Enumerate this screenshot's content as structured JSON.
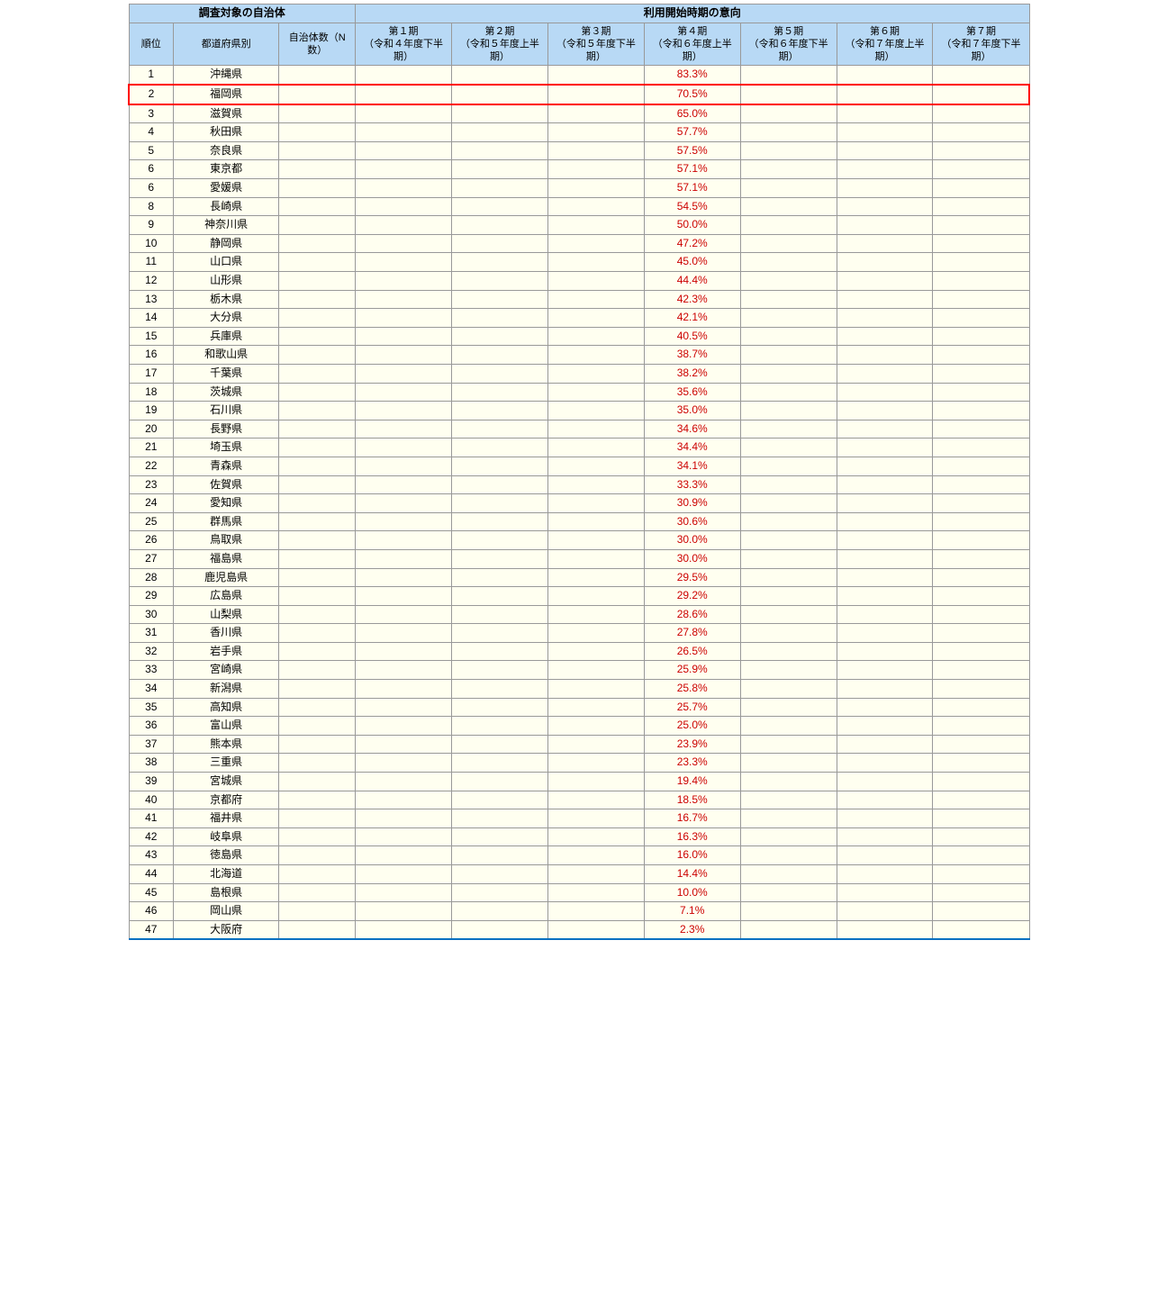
{
  "table": {
    "headers": {
      "survey_group": "調査対象の自治体",
      "intent_group": "利用開始時期の意向",
      "rank_label": "順位",
      "pref_label": "都道府県別",
      "count_label": "自治体数（N数）",
      "periods": [
        {
          "label": "第１期",
          "sub": "（令和４年度下半期）"
        },
        {
          "label": "第２期",
          "sub": "（令和５年度上半期）"
        },
        {
          "label": "第３期",
          "sub": "（令和５年度下半期）"
        },
        {
          "label": "第４期",
          "sub": "（令和６年度上半期）"
        },
        {
          "label": "第５期",
          "sub": "（令和６年度下半期）"
        },
        {
          "label": "第６期",
          "sub": "（令和７年度上半期）"
        },
        {
          "label": "第７期",
          "sub": "（令和７年度下半期）"
        }
      ]
    },
    "rows": [
      {
        "rank": "1",
        "pref": "沖縄県",
        "count": "",
        "p1": "",
        "p2": "",
        "p3": "",
        "p4": "83.3%",
        "p5": "",
        "p6": "",
        "p7": "",
        "red_outline": false,
        "blue_bottom": false
      },
      {
        "rank": "2",
        "pref": "福岡県",
        "count": "",
        "p1": "",
        "p2": "",
        "p3": "",
        "p4": "70.5%",
        "p5": "",
        "p6": "",
        "p7": "",
        "red_outline": true,
        "blue_bottom": false
      },
      {
        "rank": "3",
        "pref": "滋賀県",
        "count": "",
        "p1": "",
        "p2": "",
        "p3": "",
        "p4": "65.0%",
        "p5": "",
        "p6": "",
        "p7": "",
        "red_outline": false,
        "blue_bottom": false
      },
      {
        "rank": "4",
        "pref": "秋田県",
        "count": "",
        "p1": "",
        "p2": "",
        "p3": "",
        "p4": "57.7%",
        "p5": "",
        "p6": "",
        "p7": "",
        "red_outline": false,
        "blue_bottom": false
      },
      {
        "rank": "5",
        "pref": "奈良県",
        "count": "",
        "p1": "",
        "p2": "",
        "p3": "",
        "p4": "57.5%",
        "p5": "",
        "p6": "",
        "p7": "",
        "red_outline": false,
        "blue_bottom": false
      },
      {
        "rank": "6",
        "pref": "東京都",
        "count": "",
        "p1": "",
        "p2": "",
        "p3": "",
        "p4": "57.1%",
        "p5": "",
        "p6": "",
        "p7": "",
        "red_outline": false,
        "blue_bottom": false
      },
      {
        "rank": "6",
        "pref": "愛媛県",
        "count": "",
        "p1": "",
        "p2": "",
        "p3": "",
        "p4": "57.1%",
        "p5": "",
        "p6": "",
        "p7": "",
        "red_outline": false,
        "blue_bottom": false
      },
      {
        "rank": "8",
        "pref": "長崎県",
        "count": "",
        "p1": "",
        "p2": "",
        "p3": "",
        "p4": "54.5%",
        "p5": "",
        "p6": "",
        "p7": "",
        "red_outline": false,
        "blue_bottom": false
      },
      {
        "rank": "9",
        "pref": "神奈川県",
        "count": "",
        "p1": "",
        "p2": "",
        "p3": "",
        "p4": "50.0%",
        "p5": "",
        "p6": "",
        "p7": "",
        "red_outline": false,
        "blue_bottom": false
      },
      {
        "rank": "10",
        "pref": "静岡県",
        "count": "",
        "p1": "",
        "p2": "",
        "p3": "",
        "p4": "47.2%",
        "p5": "",
        "p6": "",
        "p7": "",
        "red_outline": false,
        "blue_bottom": false
      },
      {
        "rank": "11",
        "pref": "山口県",
        "count": "",
        "p1": "",
        "p2": "",
        "p3": "",
        "p4": "45.0%",
        "p5": "",
        "p6": "",
        "p7": "",
        "red_outline": false,
        "blue_bottom": false
      },
      {
        "rank": "12",
        "pref": "山形県",
        "count": "",
        "p1": "",
        "p2": "",
        "p3": "",
        "p4": "44.4%",
        "p5": "",
        "p6": "",
        "p7": "",
        "red_outline": false,
        "blue_bottom": false
      },
      {
        "rank": "13",
        "pref": "栃木県",
        "count": "",
        "p1": "",
        "p2": "",
        "p3": "",
        "p4": "42.3%",
        "p5": "",
        "p6": "",
        "p7": "",
        "red_outline": false,
        "blue_bottom": false
      },
      {
        "rank": "14",
        "pref": "大分県",
        "count": "",
        "p1": "",
        "p2": "",
        "p3": "",
        "p4": "42.1%",
        "p5": "",
        "p6": "",
        "p7": "",
        "red_outline": false,
        "blue_bottom": false
      },
      {
        "rank": "15",
        "pref": "兵庫県",
        "count": "",
        "p1": "",
        "p2": "",
        "p3": "",
        "p4": "40.5%",
        "p5": "",
        "p6": "",
        "p7": "",
        "red_outline": false,
        "blue_bottom": false
      },
      {
        "rank": "16",
        "pref": "和歌山県",
        "count": "",
        "p1": "",
        "p2": "",
        "p3": "",
        "p4": "38.7%",
        "p5": "",
        "p6": "",
        "p7": "",
        "red_outline": false,
        "blue_bottom": false
      },
      {
        "rank": "17",
        "pref": "千葉県",
        "count": "",
        "p1": "",
        "p2": "",
        "p3": "",
        "p4": "38.2%",
        "p5": "",
        "p6": "",
        "p7": "",
        "red_outline": false,
        "blue_bottom": false
      },
      {
        "rank": "18",
        "pref": "茨城県",
        "count": "",
        "p1": "",
        "p2": "",
        "p3": "",
        "p4": "35.6%",
        "p5": "",
        "p6": "",
        "p7": "",
        "red_outline": false,
        "blue_bottom": false
      },
      {
        "rank": "19",
        "pref": "石川県",
        "count": "",
        "p1": "",
        "p2": "",
        "p3": "",
        "p4": "35.0%",
        "p5": "",
        "p6": "",
        "p7": "",
        "red_outline": false,
        "blue_bottom": false
      },
      {
        "rank": "20",
        "pref": "長野県",
        "count": "",
        "p1": "",
        "p2": "",
        "p3": "",
        "p4": "34.6%",
        "p5": "",
        "p6": "",
        "p7": "",
        "red_outline": false,
        "blue_bottom": false
      },
      {
        "rank": "21",
        "pref": "埼玉県",
        "count": "",
        "p1": "",
        "p2": "",
        "p3": "",
        "p4": "34.4%",
        "p5": "",
        "p6": "",
        "p7": "",
        "red_outline": false,
        "blue_bottom": false
      },
      {
        "rank": "22",
        "pref": "青森県",
        "count": "",
        "p1": "",
        "p2": "",
        "p3": "",
        "p4": "34.1%",
        "p5": "",
        "p6": "",
        "p7": "",
        "red_outline": false,
        "blue_bottom": false
      },
      {
        "rank": "23",
        "pref": "佐賀県",
        "count": "",
        "p1": "",
        "p2": "",
        "p3": "",
        "p4": "33.3%",
        "p5": "",
        "p6": "",
        "p7": "",
        "red_outline": false,
        "blue_bottom": false
      },
      {
        "rank": "24",
        "pref": "愛知県",
        "count": "",
        "p1": "",
        "p2": "",
        "p3": "",
        "p4": "30.9%",
        "p5": "",
        "p6": "",
        "p7": "",
        "red_outline": false,
        "blue_bottom": false
      },
      {
        "rank": "25",
        "pref": "群馬県",
        "count": "",
        "p1": "",
        "p2": "",
        "p3": "",
        "p4": "30.6%",
        "p5": "",
        "p6": "",
        "p7": "",
        "red_outline": false,
        "blue_bottom": false
      },
      {
        "rank": "26",
        "pref": "鳥取県",
        "count": "",
        "p1": "",
        "p2": "",
        "p3": "",
        "p4": "30.0%",
        "p5": "",
        "p6": "",
        "p7": "",
        "red_outline": false,
        "blue_bottom": false
      },
      {
        "rank": "27",
        "pref": "福島県",
        "count": "",
        "p1": "",
        "p2": "",
        "p3": "",
        "p4": "30.0%",
        "p5": "",
        "p6": "",
        "p7": "",
        "red_outline": false,
        "blue_bottom": false
      },
      {
        "rank": "28",
        "pref": "鹿児島県",
        "count": "",
        "p1": "",
        "p2": "",
        "p3": "",
        "p4": "29.5%",
        "p5": "",
        "p6": "",
        "p7": "",
        "red_outline": false,
        "blue_bottom": false
      },
      {
        "rank": "29",
        "pref": "広島県",
        "count": "",
        "p1": "",
        "p2": "",
        "p3": "",
        "p4": "29.2%",
        "p5": "",
        "p6": "",
        "p7": "",
        "red_outline": false,
        "blue_bottom": false
      },
      {
        "rank": "30",
        "pref": "山梨県",
        "count": "",
        "p1": "",
        "p2": "",
        "p3": "",
        "p4": "28.6%",
        "p5": "",
        "p6": "",
        "p7": "",
        "red_outline": false,
        "blue_bottom": false
      },
      {
        "rank": "31",
        "pref": "香川県",
        "count": "",
        "p1": "",
        "p2": "",
        "p3": "",
        "p4": "27.8%",
        "p5": "",
        "p6": "",
        "p7": "",
        "red_outline": false,
        "blue_bottom": false
      },
      {
        "rank": "32",
        "pref": "岩手県",
        "count": "",
        "p1": "",
        "p2": "",
        "p3": "",
        "p4": "26.5%",
        "p5": "",
        "p6": "",
        "p7": "",
        "red_outline": false,
        "blue_bottom": false
      },
      {
        "rank": "33",
        "pref": "宮崎県",
        "count": "",
        "p1": "",
        "p2": "",
        "p3": "",
        "p4": "25.9%",
        "p5": "",
        "p6": "",
        "p7": "",
        "red_outline": false,
        "blue_bottom": false
      },
      {
        "rank": "34",
        "pref": "新潟県",
        "count": "",
        "p1": "",
        "p2": "",
        "p3": "",
        "p4": "25.8%",
        "p5": "",
        "p6": "",
        "p7": "",
        "red_outline": false,
        "blue_bottom": false
      },
      {
        "rank": "35",
        "pref": "高知県",
        "count": "",
        "p1": "",
        "p2": "",
        "p3": "",
        "p4": "25.7%",
        "p5": "",
        "p6": "",
        "p7": "",
        "red_outline": false,
        "blue_bottom": false
      },
      {
        "rank": "36",
        "pref": "富山県",
        "count": "",
        "p1": "",
        "p2": "",
        "p3": "",
        "p4": "25.0%",
        "p5": "",
        "p6": "",
        "p7": "",
        "red_outline": false,
        "blue_bottom": false
      },
      {
        "rank": "37",
        "pref": "熊本県",
        "count": "",
        "p1": "",
        "p2": "",
        "p3": "",
        "p4": "23.9%",
        "p5": "",
        "p6": "",
        "p7": "",
        "red_outline": false,
        "blue_bottom": false
      },
      {
        "rank": "38",
        "pref": "三重県",
        "count": "",
        "p1": "",
        "p2": "",
        "p3": "",
        "p4": "23.3%",
        "p5": "",
        "p6": "",
        "p7": "",
        "red_outline": false,
        "blue_bottom": false
      },
      {
        "rank": "39",
        "pref": "宮城県",
        "count": "",
        "p1": "",
        "p2": "",
        "p3": "",
        "p4": "19.4%",
        "p5": "",
        "p6": "",
        "p7": "",
        "red_outline": false,
        "blue_bottom": false
      },
      {
        "rank": "40",
        "pref": "京都府",
        "count": "",
        "p1": "",
        "p2": "",
        "p3": "",
        "p4": "18.5%",
        "p5": "",
        "p6": "",
        "p7": "",
        "red_outline": false,
        "blue_bottom": false
      },
      {
        "rank": "41",
        "pref": "福井県",
        "count": "",
        "p1": "",
        "p2": "",
        "p3": "",
        "p4": "16.7%",
        "p5": "",
        "p6": "",
        "p7": "",
        "red_outline": false,
        "blue_bottom": false
      },
      {
        "rank": "42",
        "pref": "岐阜県",
        "count": "",
        "p1": "",
        "p2": "",
        "p3": "",
        "p4": "16.3%",
        "p5": "",
        "p6": "",
        "p7": "",
        "red_outline": false,
        "blue_bottom": false
      },
      {
        "rank": "43",
        "pref": "徳島県",
        "count": "",
        "p1": "",
        "p2": "",
        "p3": "",
        "p4": "16.0%",
        "p5": "",
        "p6": "",
        "p7": "",
        "red_outline": false,
        "blue_bottom": false
      },
      {
        "rank": "44",
        "pref": "北海道",
        "count": "",
        "p1": "",
        "p2": "",
        "p3": "",
        "p4": "14.4%",
        "p5": "",
        "p6": "",
        "p7": "",
        "red_outline": false,
        "blue_bottom": false
      },
      {
        "rank": "45",
        "pref": "島根県",
        "count": "",
        "p1": "",
        "p2": "",
        "p3": "",
        "p4": "10.0%",
        "p5": "",
        "p6": "",
        "p7": "",
        "red_outline": false,
        "blue_bottom": false
      },
      {
        "rank": "46",
        "pref": "岡山県",
        "count": "",
        "p1": "",
        "p2": "",
        "p3": "",
        "p4": "7.1%",
        "p5": "",
        "p6": "",
        "p7": "",
        "red_outline": false,
        "blue_bottom": false
      },
      {
        "rank": "47",
        "pref": "大阪府",
        "count": "",
        "p1": "",
        "p2": "",
        "p3": "",
        "p4": "2.3%",
        "p5": "",
        "p6": "",
        "p7": "",
        "red_outline": false,
        "blue_bottom": true
      }
    ]
  }
}
